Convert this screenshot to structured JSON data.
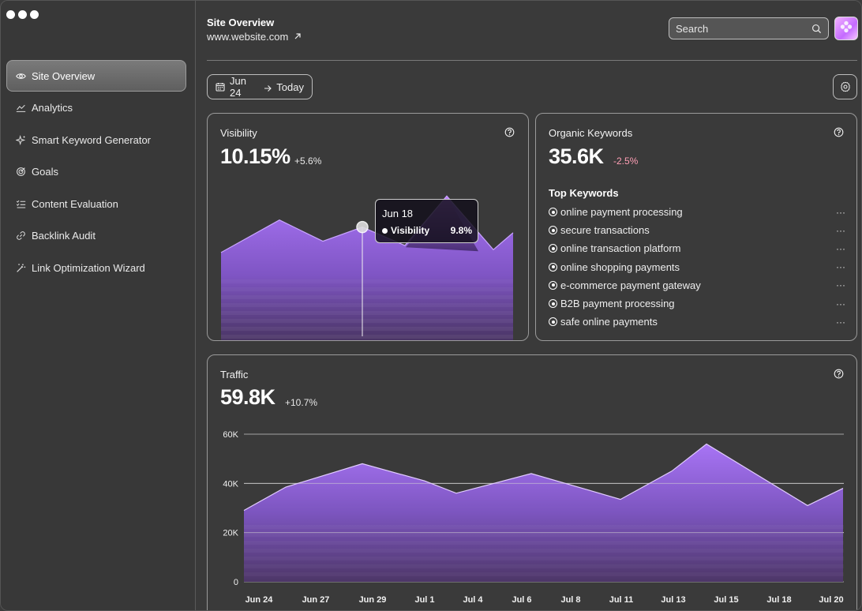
{
  "window": {
    "controls": [
      "close",
      "minimize",
      "maximize"
    ]
  },
  "sidebar": {
    "items": [
      {
        "label": "Site Overview",
        "icon": "eye-icon",
        "active": true
      },
      {
        "label": "Analytics",
        "icon": "line-chart-icon",
        "active": false
      },
      {
        "label": "Smart Keyword Generator",
        "icon": "sparkle-icon",
        "active": false
      },
      {
        "label": "Goals",
        "icon": "target-icon",
        "active": false
      },
      {
        "label": "Content Evaluation",
        "icon": "checklist-icon",
        "active": false
      },
      {
        "label": "Backlink Audit",
        "icon": "link-icon",
        "active": false
      },
      {
        "label": "Link Optimization Wizard",
        "icon": "magic-wand-icon",
        "active": false
      }
    ]
  },
  "header": {
    "title": "Site Overview",
    "url": "www.website.com",
    "url_icon": "external-arrow-icon",
    "search_placeholder": "Search",
    "search_icon": "search-icon",
    "avatar_icon": "avatar-flower-icon"
  },
  "toolbar": {
    "date_from": "Jun 24",
    "date_to": "Today",
    "calendar_icon": "calendar-icon",
    "settings_icon": "gear-icon"
  },
  "visibility": {
    "title": "Visibility",
    "value": "10.15%",
    "delta": "+5.6%",
    "tooltip": {
      "date": "Jun 18",
      "label": "Visibility",
      "value": "9.8%"
    }
  },
  "organic": {
    "title": "Organic Keywords",
    "value": "35.6K",
    "delta": "-2.5%",
    "top_heading": "Top Keywords",
    "keywords": [
      "online payment processing",
      "secure transactions",
      "online transaction platform",
      "online shopping payments",
      "e-commerce payment gateway",
      "B2B payment processing",
      "safe online payments"
    ],
    "more_label": "···"
  },
  "traffic": {
    "title": "Traffic",
    "value": "59.8K",
    "delta": "+10.7%"
  },
  "colors": {
    "accent": "#a76cf2",
    "accent_dark": "#5c3f80",
    "background": "#3a3a3a",
    "negative": "#ff9fb5"
  },
  "chart_data": [
    {
      "type": "area",
      "title": "Visibility",
      "x": [
        0,
        1,
        2,
        3,
        4,
        5,
        6,
        7
      ],
      "series": [
        {
          "values": [
            6.2,
            8.5,
            7.0,
            8.0,
            6.7,
            10.2,
            6.4,
            7.6
          ]
        }
      ],
      "ylim": [
        0,
        12
      ],
      "grid": false,
      "highlight_index": 3
    },
    {
      "type": "area",
      "title": "Traffic",
      "categories": [
        "Jun 24",
        "Jun 27",
        "Jun 29",
        "Jul 1",
        "Jul 4",
        "Jul 6",
        "Jul 8",
        "Jul 11",
        "Jul 13",
        "Jul 15",
        "Jul 18",
        "Jul 20"
      ],
      "x_points": [
        0,
        1,
        2,
        3,
        4,
        5,
        6,
        7,
        8,
        9,
        10,
        11
      ],
      "series": [
        {
          "values": [
            29000,
            38500,
            48000,
            41000,
            36000,
            44000,
            37500,
            33500,
            45000,
            56000,
            31000,
            38000
          ]
        }
      ],
      "yticks": [
        "60K",
        "40K",
        "20K",
        "0"
      ],
      "ylim": [
        0,
        60000
      ],
      "grid": true
    }
  ]
}
